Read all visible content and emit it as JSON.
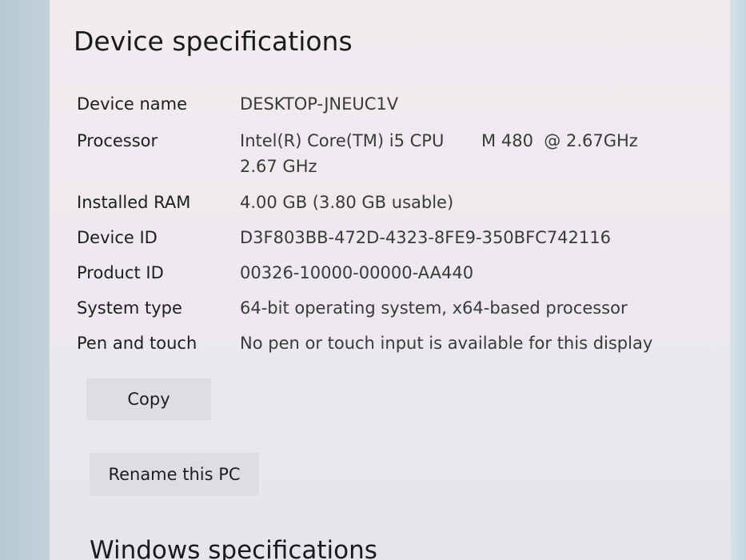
{
  "page": {
    "title": "Device specifications",
    "next_section_title": "Windows specifications"
  },
  "specs": [
    {
      "label": "Device name",
      "value": "DESKTOP-JNEUC1V"
    },
    {
      "label": "Processor",
      "value": "Intel(R) Core(TM) i5 CPU       M 480  @ 2.67GHz\n2.67 GHz"
    },
    {
      "label": "Installed RAM",
      "value": "4.00 GB (3.80 GB usable)"
    },
    {
      "label": "Device ID",
      "value": "D3F803BB-472D-4323-8FE9-350BFC742116"
    },
    {
      "label": "Product ID",
      "value": "00326-10000-00000-AA440"
    },
    {
      "label": "System type",
      "value": "64-bit operating system, x64-based processor"
    },
    {
      "label": "Pen and touch",
      "value": "No pen or touch input is available for this display"
    }
  ],
  "buttons": {
    "copy_label": "Copy",
    "rename_label": "Rename this PC"
  }
}
